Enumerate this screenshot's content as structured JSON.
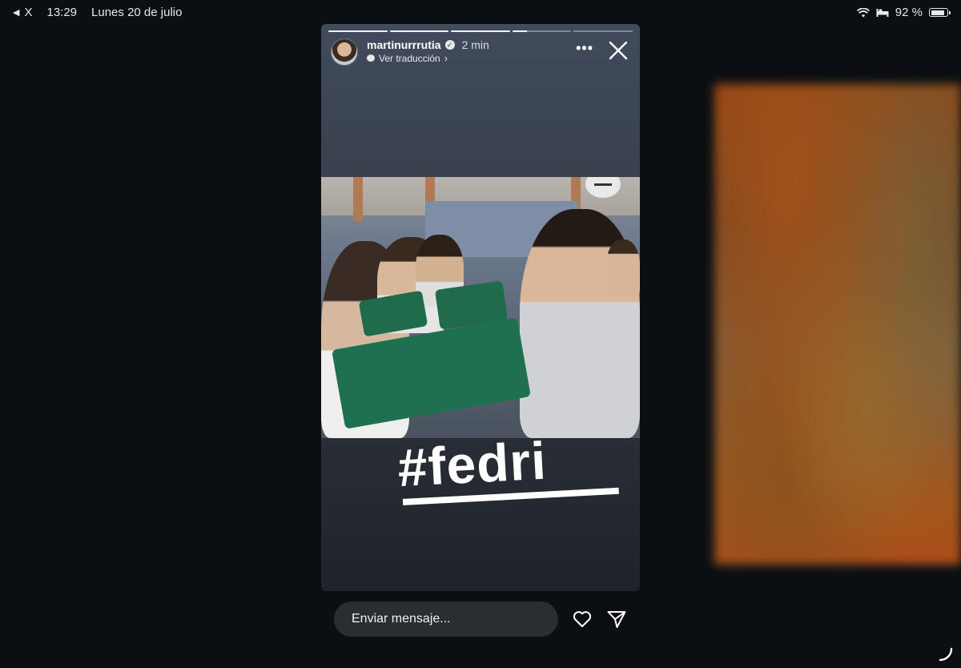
{
  "status_bar": {
    "back_label": "X",
    "time": "13:29",
    "date": "Lunes 20 de julio",
    "battery_text": "92 %",
    "battery_level": 0.92
  },
  "story": {
    "progress_fill": [
      1,
      1,
      1,
      0.25,
      0
    ],
    "username": "martinurrrutia",
    "verified_mark": "✓",
    "time_ago": "2 min",
    "translate_label": "Ver traducción",
    "chevron": "›",
    "more": "•••",
    "hashtag": "#fedri"
  },
  "bottom_bar": {
    "message_placeholder": "Enviar mensaje..."
  }
}
